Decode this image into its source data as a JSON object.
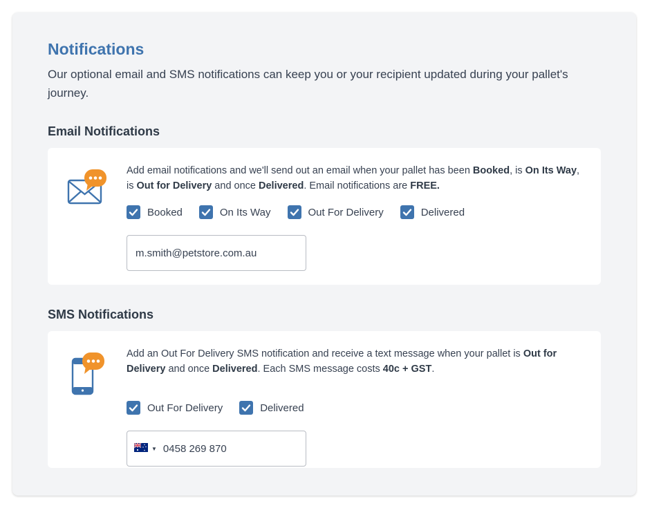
{
  "header": {
    "title": "Notifications",
    "intro": "Our optional email and SMS notifications can keep you or your recipient updated during your pallet's journey."
  },
  "email": {
    "heading": "Email Notifications",
    "description": {
      "t1": "Add email notifications and we'll send out an email when your pallet has been ",
      "b1": "Booked",
      "t2": ", is ",
      "b2": "On Its Way",
      "t3": ", is ",
      "b3": "Out for Delivery",
      "t4": " and once ",
      "b4": "Delivered",
      "t5": ". Email notifications are ",
      "b5": "FREE."
    },
    "options": [
      {
        "label": "Booked",
        "checked": true
      },
      {
        "label": "On Its Way",
        "checked": true
      },
      {
        "label": "Out For Delivery",
        "checked": true
      },
      {
        "label": "Delivered",
        "checked": true
      }
    ],
    "email_value": "m.smith@petstore.com.au"
  },
  "sms": {
    "heading": "SMS Notifications",
    "description": {
      "t1": "Add an Out For Delivery SMS notification and receive a text message when your pallet is ",
      "b1": "Out for Delivery",
      "t2": " and once ",
      "b2": "Delivered",
      "t3": ". Each SMS message costs ",
      "b3": "40c + GST",
      "t4": "."
    },
    "options": [
      {
        "label": "Out For Delivery",
        "checked": true
      },
      {
        "label": "Delivered",
        "checked": true
      }
    ],
    "country_flag_icon": "australia-flag-icon",
    "phone_value": "0458 269 870"
  },
  "colors": {
    "accent": "#3f74ae",
    "bubble": "#f0932b",
    "panel_bg": "#f3f4f6"
  },
  "icons": {
    "email_card": "envelope-chat-icon",
    "sms_card": "phone-chat-icon",
    "checkbox": "checkmark-icon"
  }
}
